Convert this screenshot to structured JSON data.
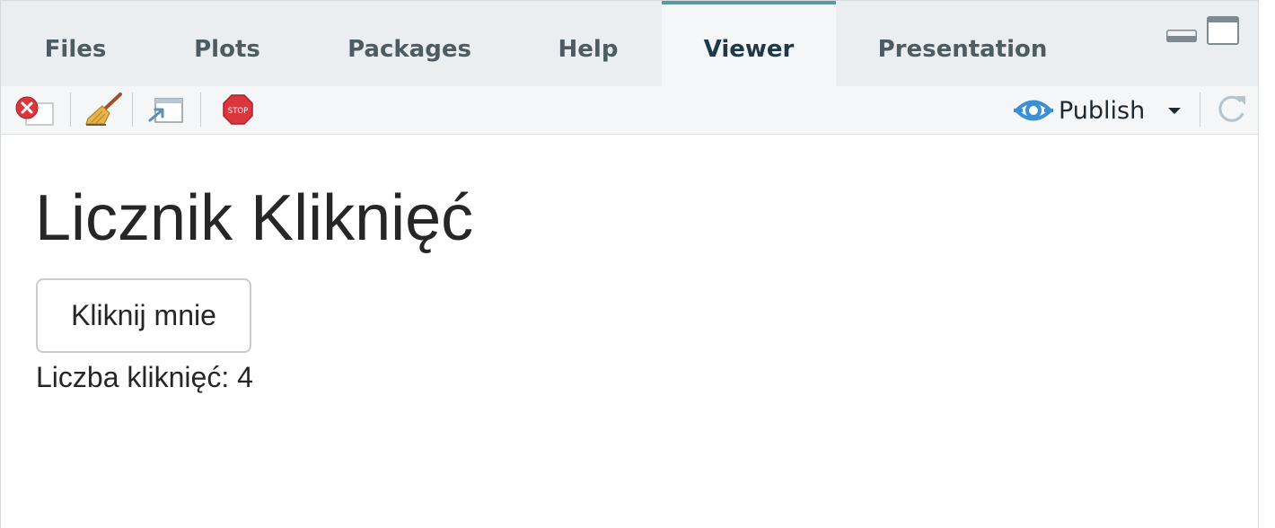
{
  "tabs": [
    {
      "label": "Files"
    },
    {
      "label": "Plots"
    },
    {
      "label": "Packages"
    },
    {
      "label": "Help"
    },
    {
      "label": "Viewer",
      "active": true
    },
    {
      "label": "Presentation"
    }
  ],
  "toolbar": {
    "publish_label": "Publish",
    "stop_icon_text": "STOP",
    "accent_color": "#3b8fd6"
  },
  "viewer": {
    "title": "Licznik Kliknięć",
    "button_label": "Kliknij mnie",
    "count_label": "Liczba kliknięć:",
    "count_value": "4"
  },
  "colors": {
    "tabbar_bg": "#ebeef0",
    "active_tab_bg": "#f5f6f7",
    "active_tab_border": "#5a9aa5",
    "toolbar_bg": "#f5f6f7"
  }
}
